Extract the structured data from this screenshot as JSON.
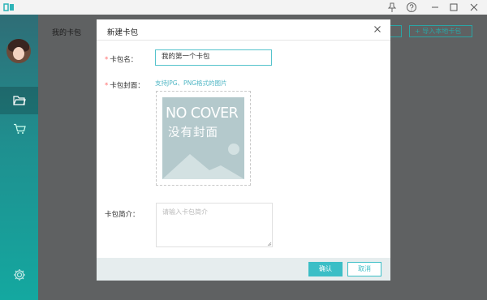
{
  "titlebar": {
    "icons": [
      "app-logo-icon",
      "pin-icon",
      "help-icon",
      "minimize-icon",
      "maximize-icon",
      "close-icon"
    ]
  },
  "sidebar": {
    "items": [
      {
        "name": "folder-icon",
        "active": true
      },
      {
        "name": "cart-icon",
        "active": false
      }
    ],
    "settings_icon": "gear-icon"
  },
  "main": {
    "title": "我的卡包",
    "import_button": "+ 导入本地卡包"
  },
  "modal": {
    "title": "新建卡包",
    "name_label": "卡包名：",
    "name_value": "我的第一个卡包",
    "cover_label": "卡包封面：",
    "cover_hint": "支持JPG、PNG格式的图片",
    "cover_placeholder_en": "NO COVER",
    "cover_placeholder_cn": "没有封面",
    "intro_label": "卡包简介：",
    "intro_placeholder": "请输入卡包简介",
    "confirm_button": "确认",
    "cancel_button": "取消"
  },
  "colors": {
    "accent": "#3bbec6",
    "required": "#ff6b6b",
    "overlay": "#5f6162"
  }
}
